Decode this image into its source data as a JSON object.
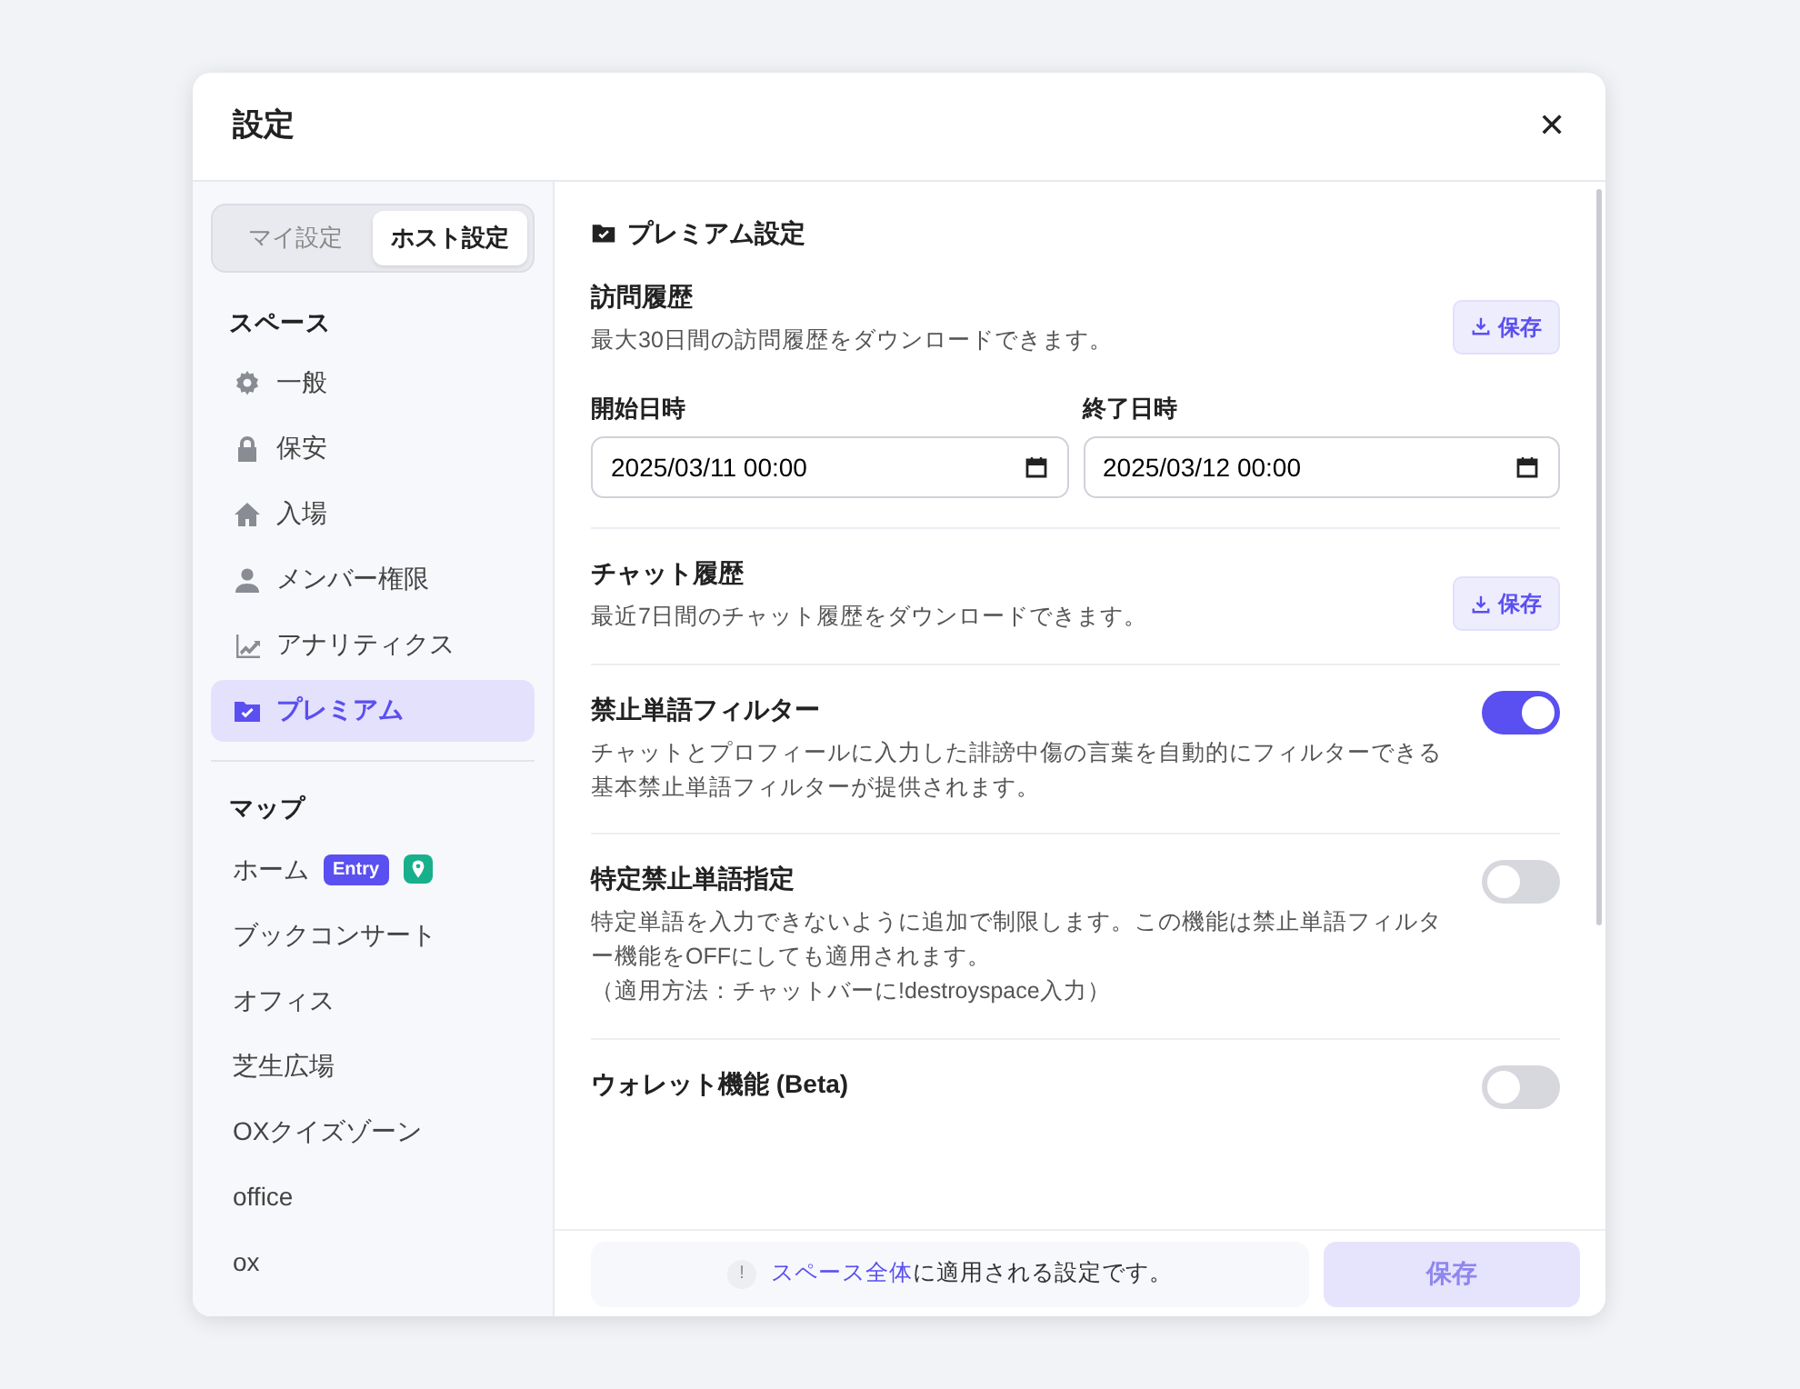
{
  "dialog": {
    "title": "設定",
    "close": "✕"
  },
  "scope_tabs": [
    {
      "label": "マイ設定",
      "selected": false
    },
    {
      "label": "ホスト設定",
      "selected": true
    }
  ],
  "sidebar": {
    "sections": [
      {
        "heading": "スペース",
        "items": [
          {
            "label": "一般",
            "kind": "gear",
            "selected": false
          },
          {
            "label": "保安",
            "kind": "lock",
            "selected": false
          },
          {
            "label": "入場",
            "kind": "house",
            "selected": false
          },
          {
            "label": "メンバー権限",
            "kind": "person",
            "selected": false
          },
          {
            "label": "アナリティクス",
            "kind": "chart",
            "selected": false
          },
          {
            "label": "プレミアム",
            "kind": "folder",
            "selected": true
          }
        ]
      },
      {
        "heading": "マップ",
        "items": [
          {
            "label": "ホーム",
            "badge": "Entry",
            "pinned": true,
            "selected": false
          },
          {
            "label": "ブックコンサート",
            "pinned": false,
            "selected": false
          },
          {
            "label": "オフィス",
            "pinned": false,
            "selected": false
          },
          {
            "label": "芝生広場",
            "pinned": false,
            "selected": false
          },
          {
            "label": "OXクイズゾーン",
            "pinned": false,
            "selected": false
          },
          {
            "label": "office",
            "pinned": false,
            "selected": false
          },
          {
            "label": "ox",
            "pinned": false,
            "selected": false
          }
        ]
      }
    ]
  },
  "content": {
    "title": "プレミアム設定",
    "settings": [
      {
        "kind": "download",
        "title": "訪問履歴",
        "description": "最大30日間の訪問履歴をダウンロードできます。",
        "button": "保存",
        "dates": [
          {
            "label": "開始日時",
            "value": "2025/03/11 00:00"
          },
          {
            "label": "終了日時",
            "value": "2025/03/12 00:00"
          }
        ]
      },
      {
        "kind": "download",
        "title": "チャット履歴",
        "description": "最近7日間のチャット履歴をダウンロードできます。",
        "button": "保存"
      },
      {
        "kind": "toggle",
        "title": "禁止単語フィルター",
        "description": "チャットとプロフィールに入力した誹謗中傷の言葉を自動的にフィルターできる基本禁止単語フィルターが提供されます。",
        "on": true
      },
      {
        "kind": "toggle",
        "title": "特定禁止単語指定",
        "description": "特定単語を入力できないように追加で制限します。この機能は禁止単語フィルター機能をOFFにしても適用されます。",
        "note": "（適用方法：チャットバーに!destroyspace入力）",
        "on": false
      },
      {
        "kind": "toggle",
        "title": "ウォレット機能 (Beta)",
        "on": false
      }
    ]
  },
  "footer": {
    "note_icon": "!",
    "note_link": "スペース全体",
    "note_text": "に適用される設定です。",
    "save": {
      "label": "保存",
      "disabled": true
    }
  }
}
